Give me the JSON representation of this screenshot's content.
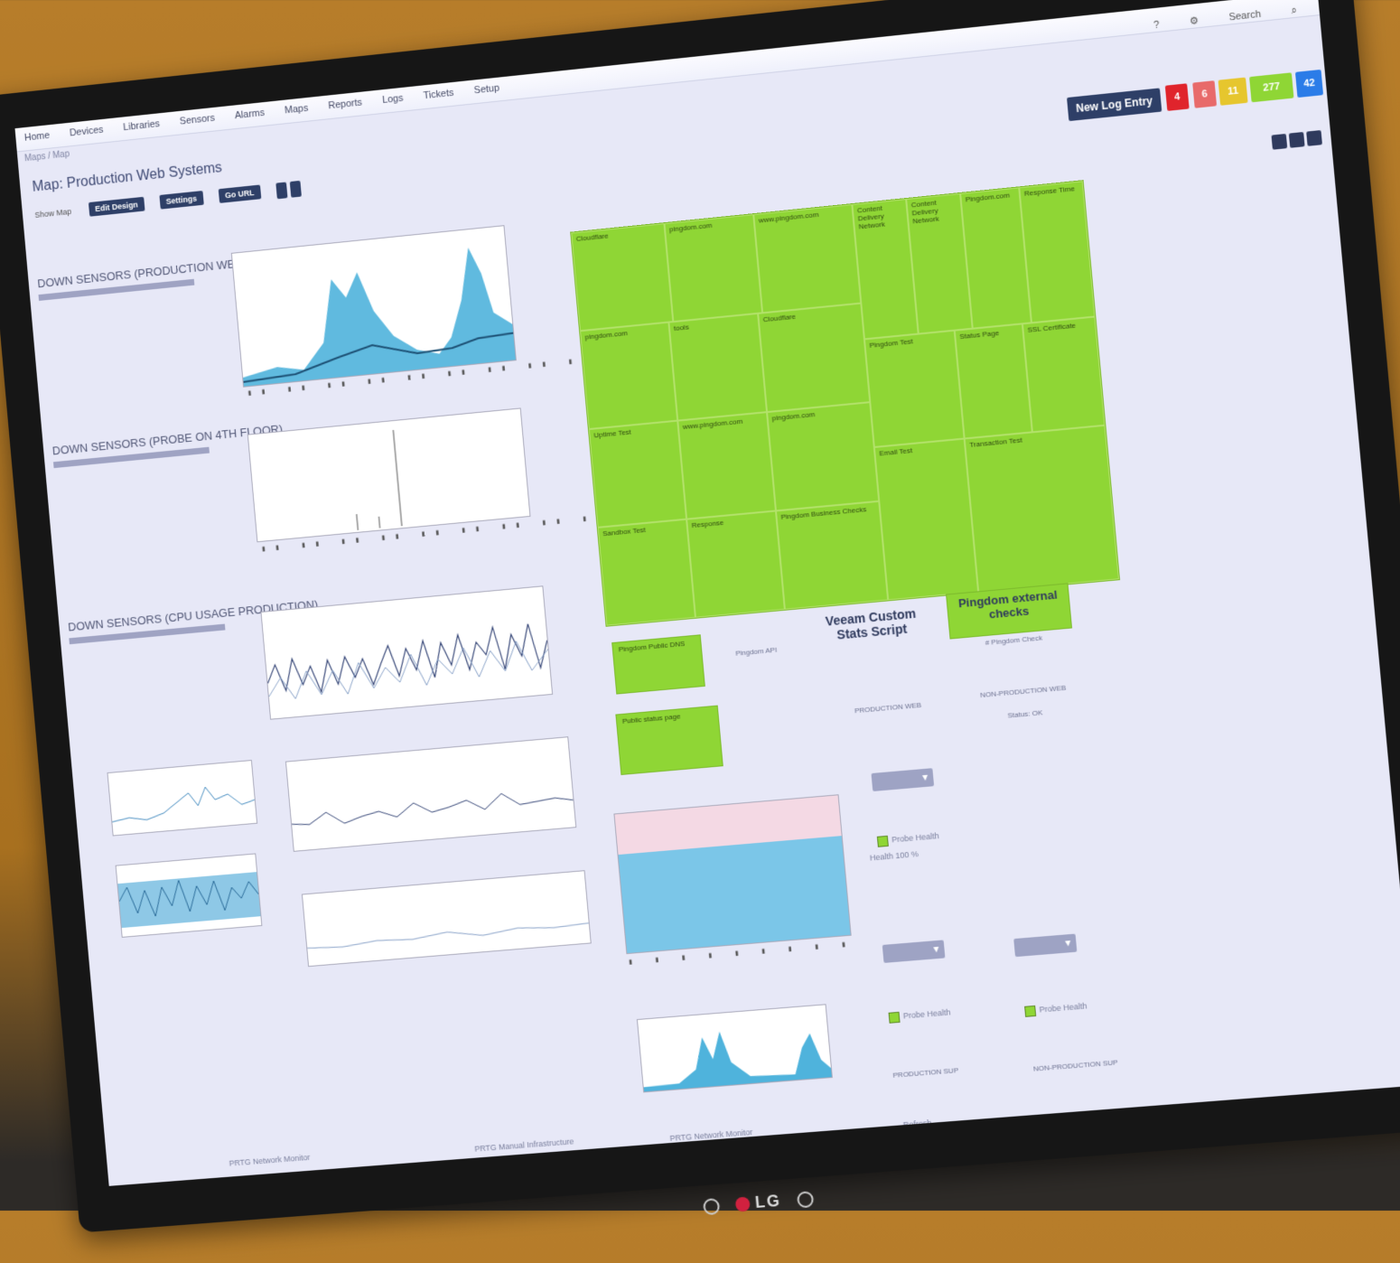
{
  "menu": {
    "items": [
      "Home",
      "Devices",
      "Libraries",
      "Sensors",
      "Alarms",
      "Maps",
      "Reports",
      "Logs",
      "Tickets",
      "Setup"
    ],
    "breadcrumb": "Maps / Map"
  },
  "header": {
    "search_placeholder": "Search",
    "new_log_entry": "New Log Entry",
    "status_counts": [
      {
        "label": "4",
        "color": "#e0242c"
      },
      {
        "label": "6",
        "color": "#e86a6a"
      },
      {
        "label": "11",
        "color": "#e6c62e"
      },
      {
        "label": "277",
        "color": "#8fd635"
      },
      {
        "label": "42",
        "color": "#2b7ce8"
      }
    ]
  },
  "map": {
    "title": "Map: Production Web Systems",
    "toolbar": {
      "show_map": "Show Map",
      "buttons": [
        "Edit Design",
        "Settings",
        "Go URL"
      ]
    }
  },
  "sections": [
    {
      "title": "DOWN SENSORS (PRODUCTION WEB TESTS)"
    },
    {
      "title": "DOWN SENSORS (PROBE ON 4TH FLOOR)"
    },
    {
      "title": "DOWN SENSORS (CPU USAGE PRODUCTION)"
    }
  ],
  "treemap": {
    "cells": [
      "Cloudflare",
      "pingdom.com",
      "www.pingdom.com",
      "Content Delivery Network",
      "Content Delivery Network",
      "Pingdom.com",
      "Response Time",
      "pingdom.com",
      "tools",
      "Cloudflare",
      "Uptime Test",
      "www.pingdom.com",
      "pingdom.com",
      "Pingdom Test",
      "Status Page",
      "SSL Certificate",
      "Sandbox Test",
      "Response",
      "Pingdom Business Checks",
      "Email Test",
      "Transaction Test"
    ]
  },
  "tiles": {
    "left_box_1": "Pingdom Public DNS",
    "left_box_2": "Public status page",
    "pingdom_api": "Pingdom API",
    "veeam": "Veeam Custom Stats Script",
    "pingdom_ext": "Pingdom external checks",
    "pingdom_ext_sub": "# Pingdom Check",
    "production_web": "PRODUCTION WEB",
    "non_production_web": "NON-PRODUCTION WEB",
    "non_production_web_sub": "Status: OK",
    "probe_health": "Probe Health",
    "health": "Health",
    "health_pct": "100 %",
    "production_sup": "PRODUCTION SUP",
    "non_production_sup": "NON-PRODUCTION SUP"
  },
  "bottom_status": [
    "PRTG Network Monitor",
    "PRTG Manual Infrastructure",
    "PRTG Network Monitor",
    "Refresh"
  ]
}
